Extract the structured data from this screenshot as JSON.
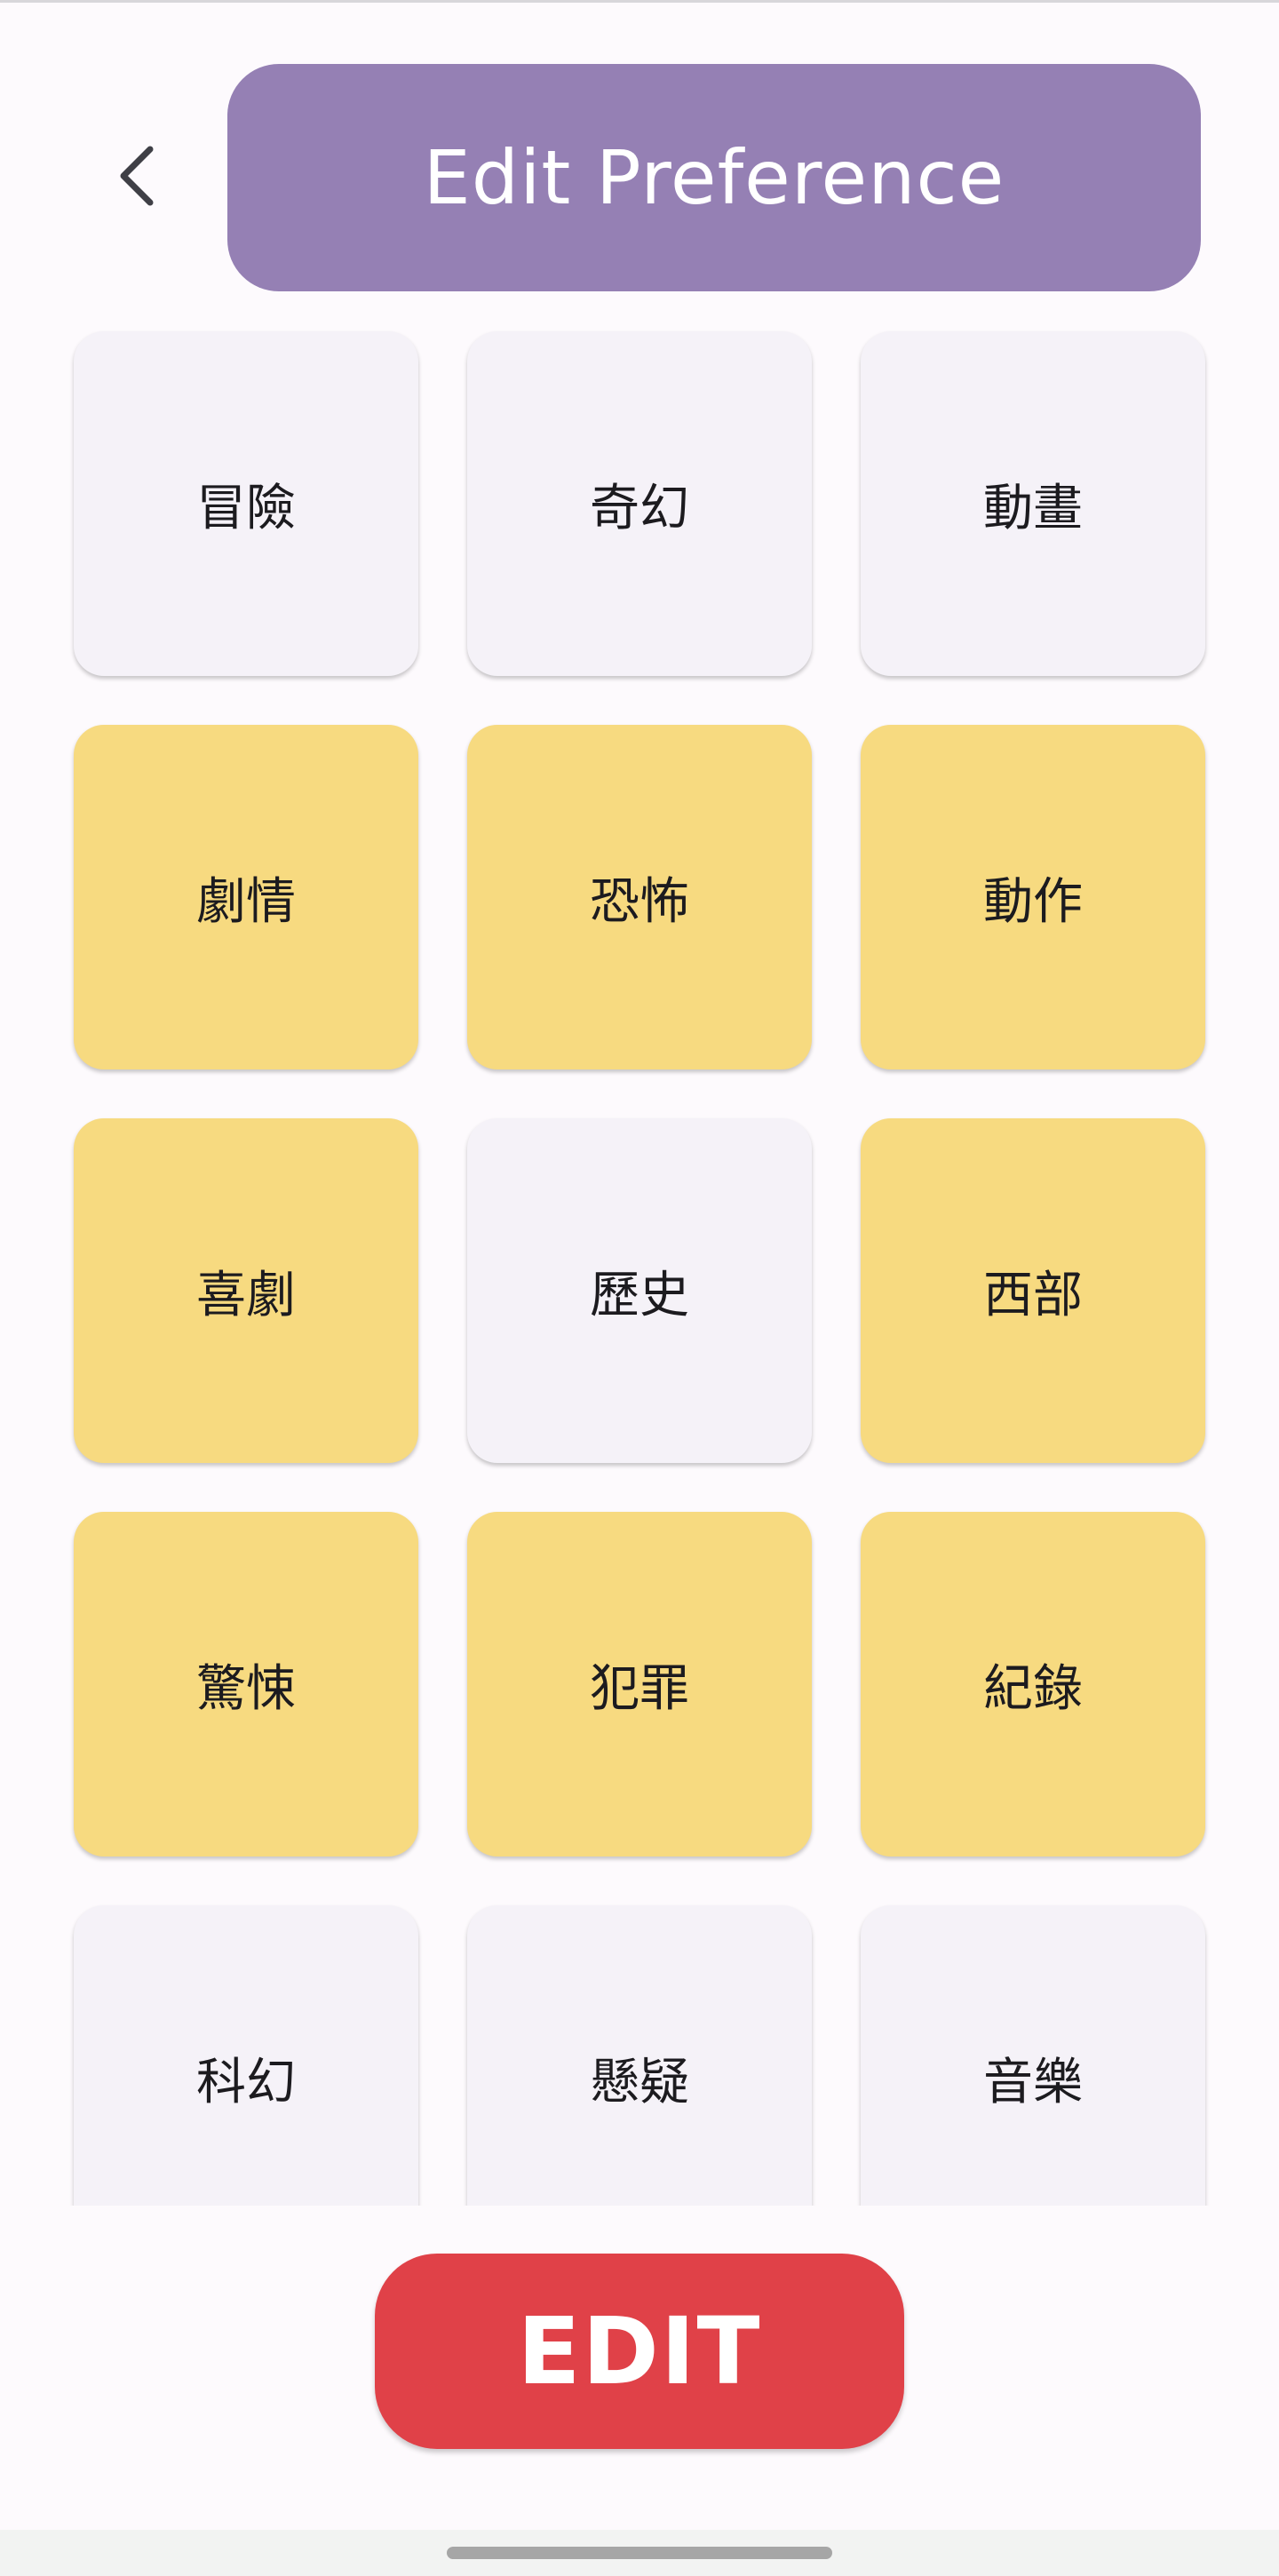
{
  "header": {
    "title": "Edit Preference",
    "back_icon": "chevron-left-icon"
  },
  "colors": {
    "header_background": "#9580b4",
    "selected_card": "#f7da80",
    "unselected_card": "#f5f2f8",
    "edit_button": "#e04148"
  },
  "genres": [
    {
      "label": "冒險",
      "selected": false
    },
    {
      "label": "奇幻",
      "selected": false
    },
    {
      "label": "動畫",
      "selected": false
    },
    {
      "label": "劇情",
      "selected": true
    },
    {
      "label": "恐怖",
      "selected": true
    },
    {
      "label": "動作",
      "selected": true
    },
    {
      "label": "喜劇",
      "selected": true
    },
    {
      "label": "歷史",
      "selected": false
    },
    {
      "label": "西部",
      "selected": true
    },
    {
      "label": "驚悚",
      "selected": true
    },
    {
      "label": "犯罪",
      "selected": true
    },
    {
      "label": "紀錄",
      "selected": true
    },
    {
      "label": "科幻",
      "selected": false
    },
    {
      "label": "懸疑",
      "selected": false
    },
    {
      "label": "音樂",
      "selected": false
    }
  ],
  "footer": {
    "edit_label": "EDIT"
  }
}
